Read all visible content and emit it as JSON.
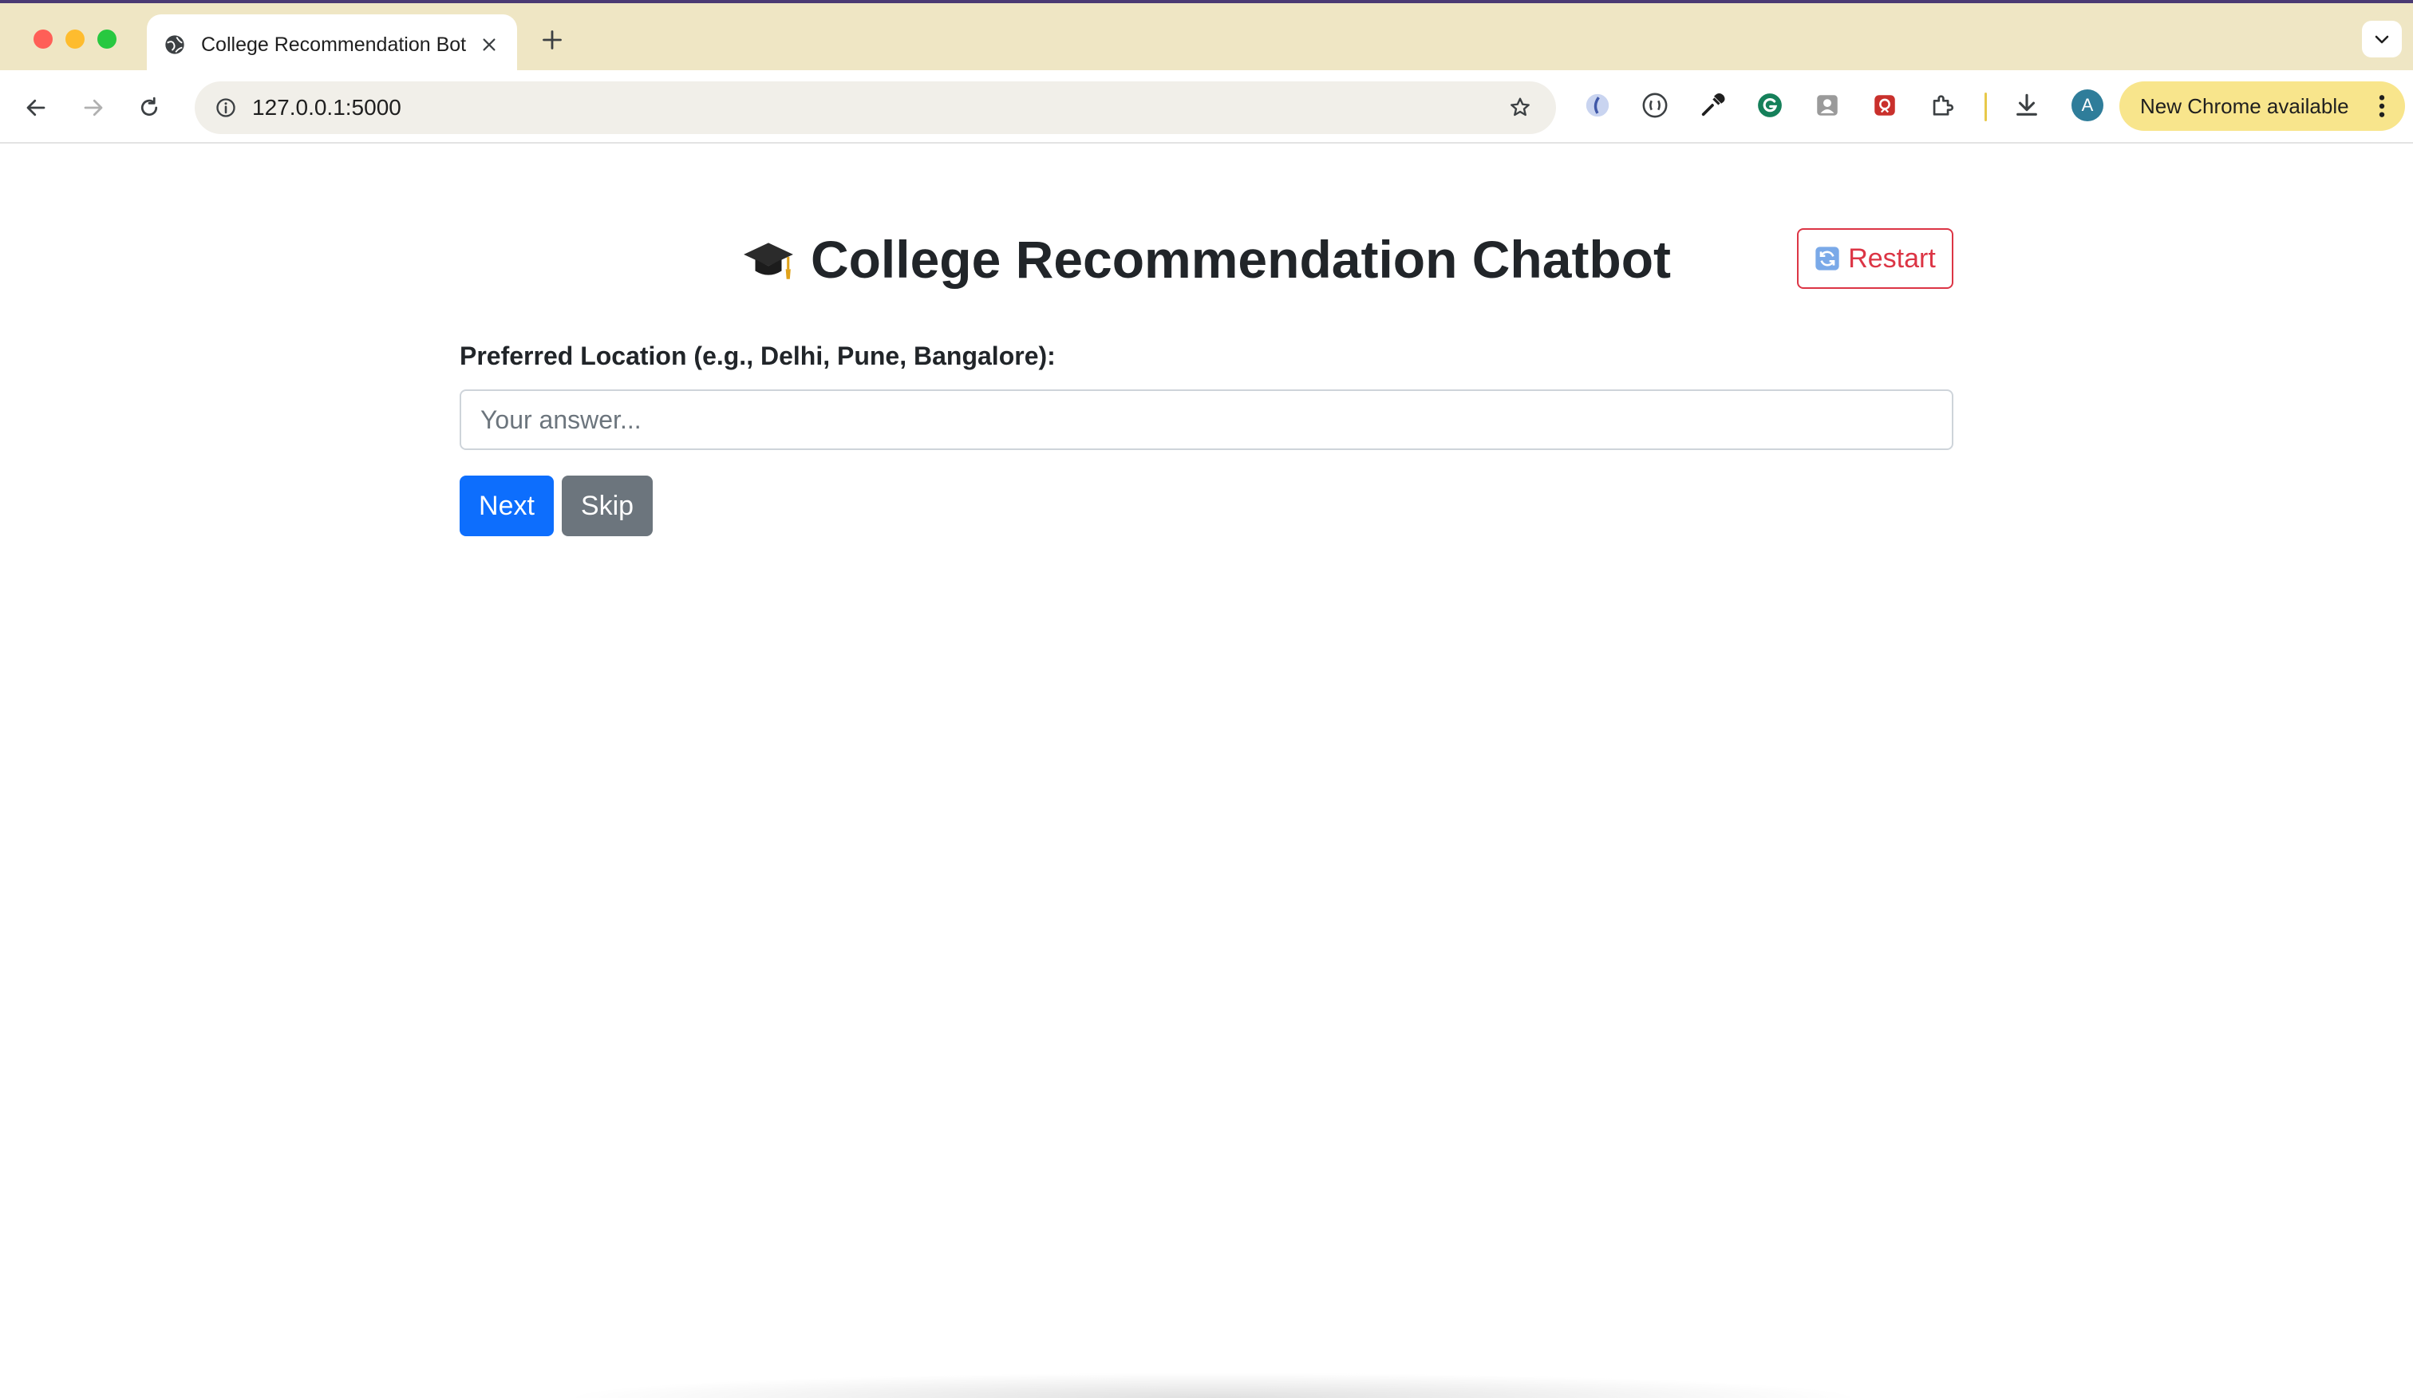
{
  "browser": {
    "tab": {
      "title": "College Recommendation Bot",
      "favicon": "globe-icon"
    },
    "address_bar": {
      "url": "127.0.0.1:5000"
    },
    "extensions": [
      "circle-extension-icon",
      "bracket-extension-icon",
      "eyedropper-extension-icon",
      "grammarly-icon",
      "portrait-extension-icon",
      "shield-extension-icon",
      "puzzle-extensions-icon"
    ],
    "profile_initial": "A",
    "update_label": "New Chrome available"
  },
  "page": {
    "title": "College Recommendation Chatbot",
    "title_icon": "graduation-cap-icon",
    "restart_label": "Restart",
    "question_label": "Preferred Location (e.g., Delhi, Pune, Bangalore):",
    "answer": {
      "value": "",
      "placeholder": "Your answer..."
    },
    "next_label": "Next",
    "skip_label": "Skip"
  },
  "colors": {
    "primary": "#0d6efd",
    "secondary": "#6c757d",
    "danger": "#dc3545",
    "tabbar": "#efe6c4",
    "update_pill": "#f8e58c"
  }
}
